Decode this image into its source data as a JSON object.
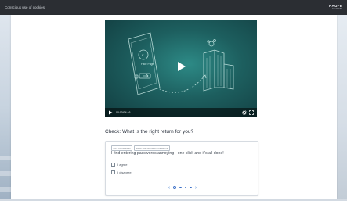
{
  "topbar": {
    "title": "Conscious use of cookies",
    "brand": "HAUFE",
    "brand_sub": "AKADEMIE"
  },
  "video": {
    "scene_label": "Face Page",
    "time": "00:00/04:16",
    "icons": [
      "play-icon",
      "gear-icon",
      "fullscreen-icon"
    ]
  },
  "question": {
    "prompt": "Check: What is the right return for you?",
    "tags": [
      "GET YOUR DATA",
      "INDICATE ANSWER CORRECT"
    ],
    "statement": "I find entering passwords annoying - one click and it's all done!",
    "options": [
      "I agree",
      "I disagree"
    ],
    "pager": {
      "total": 4,
      "current": 1
    }
  },
  "colors": {
    "topbar": "#2b2e33",
    "video_teal": "#1d5f5f",
    "accent_blue": "#3b6fc7"
  }
}
